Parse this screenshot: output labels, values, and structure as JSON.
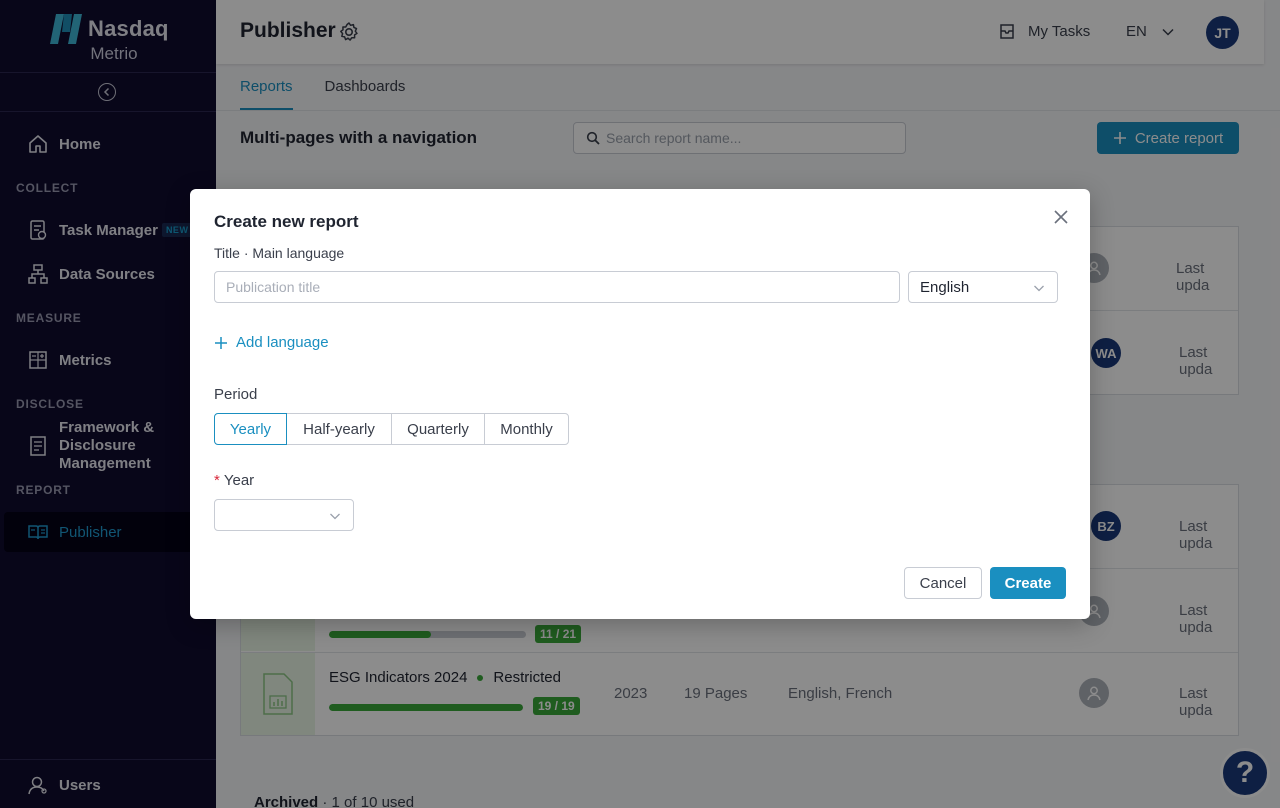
{
  "sidebar": {
    "brand": "Nasdaq",
    "product": "Metrio",
    "sections": {
      "collect": "COLLECT",
      "measure": "MEASURE",
      "disclose": "DISCLOSE",
      "report": "REPORT"
    },
    "items": {
      "home": "Home",
      "task_manager": "Task Manager",
      "task_manager_badge": "NEW",
      "data_sources": "Data Sources",
      "metrics": "Metrics",
      "framework_line1": "Framework &",
      "framework_line2": "Disclosure",
      "framework_line3": "Management",
      "publisher": "Publisher",
      "users": "Users"
    }
  },
  "header": {
    "title": "Publisher",
    "my_tasks": "My Tasks",
    "language": "EN",
    "user_initials": "JT"
  },
  "tabs": [
    "Reports",
    "Dashboards"
  ],
  "content": {
    "section_title": "Multi-pages with a navigation",
    "search_placeholder": "Search report name...",
    "create_report": "Create report",
    "rows": [
      {
        "last_updated": "Last upda"
      },
      {
        "avatar": "WA",
        "last_updated": "Last upda"
      },
      {
        "avatar": "BZ",
        "last_updated": "Last upda"
      },
      {
        "progress": "11 / 21",
        "progress_fraction": 0.52,
        "last_updated": "Last upda"
      },
      {
        "title": "ESG Indicators 2024",
        "status": "Restricted",
        "progress": "19 / 19",
        "progress_fraction": 1.0,
        "year": "2023",
        "pages": "19 Pages",
        "languages": "English, French",
        "last_updated": "Last upda"
      }
    ],
    "archived_label": "Archived",
    "archived_usage": "· 1 of 10 used"
  },
  "modal": {
    "title": "Create new report",
    "title_label": "Title · Main language",
    "title_placeholder": "Publication title",
    "language_value": "English",
    "add_language": "Add language",
    "period_label": "Period",
    "periods": [
      "Yearly",
      "Half-yearly",
      "Quarterly",
      "Monthly"
    ],
    "active_period": "Yearly",
    "year_label": "Year",
    "year_required_mark": "*",
    "year_value": "",
    "cancel": "Cancel",
    "create": "Create"
  },
  "help_label": "?",
  "colors": {
    "sidebar_bg": "#0f0c2e",
    "accent": "#1a8fc0",
    "progress_green": "#3aa83a",
    "avatar_blue": "#1b3a7a"
  }
}
